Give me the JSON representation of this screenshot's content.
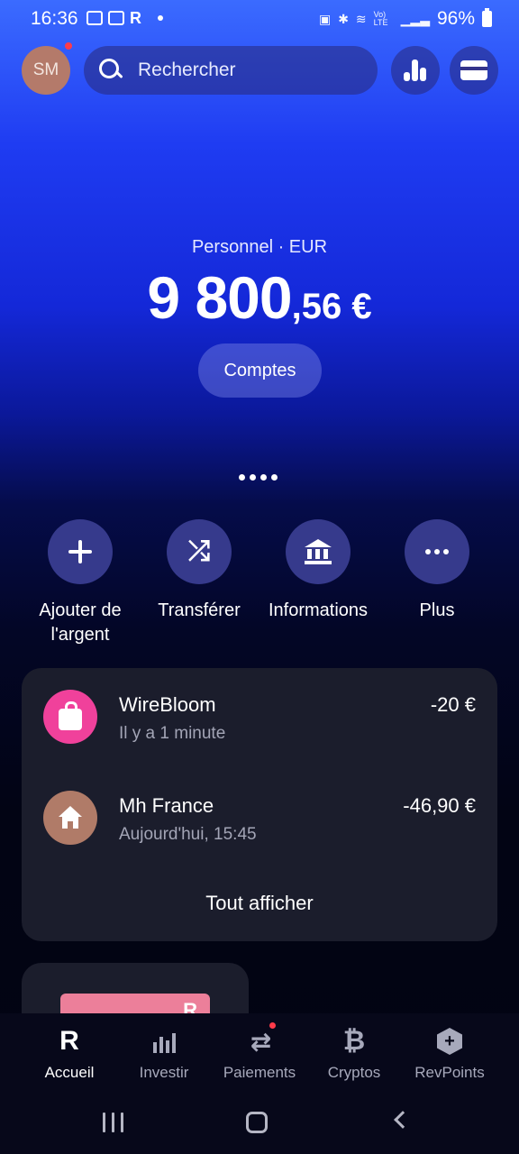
{
  "status_bar": {
    "time": "16:36",
    "r_glyph": "R",
    "battery": "96%",
    "volte": "Vo) LTE"
  },
  "header": {
    "avatar_initials": "SM",
    "search_placeholder": "Rechercher"
  },
  "balance": {
    "label": "Personnel · EUR",
    "integer": "9 800",
    "decimal": ",56 €",
    "accounts_button": "Comptes"
  },
  "actions": [
    {
      "label": "Ajouter de l'argent",
      "icon": "plus-icon"
    },
    {
      "label": "Transférer",
      "icon": "shuffle-icon"
    },
    {
      "label": "Informations",
      "icon": "bank-icon"
    },
    {
      "label": "Plus",
      "icon": "more-icon"
    }
  ],
  "transactions": [
    {
      "name": "WireBloom",
      "sub": "Il y a 1 minute",
      "amount": "-20 €",
      "icon": "shopping-bag-icon",
      "color": "#f0419b"
    },
    {
      "name": "Mh France",
      "sub": "Aujourd'hui, 15:45",
      "amount": "-46,90 €",
      "icon": "home-icon",
      "color": "#b07b68"
    }
  ],
  "transactions_show_all": "Tout afficher",
  "promo_glyph": "R",
  "bottom_nav": [
    {
      "label": "Accueil",
      "icon": "revolut-logo-icon",
      "active": true
    },
    {
      "label": "Investir",
      "icon": "investment-chart-icon",
      "active": false
    },
    {
      "label": "Paiements",
      "icon": "transfer-arrows-icon",
      "active": false
    },
    {
      "label": "Cryptos",
      "icon": "bitcoin-icon",
      "active": false
    },
    {
      "label": "RevPoints",
      "icon": "revpoints-hex-icon",
      "active": false
    }
  ],
  "nav_glyphs": {
    "home": "R",
    "payments": "⇄",
    "crypto": "₿",
    "revpoints": "+"
  },
  "colors": {
    "accent_blue": "#1f3cf2",
    "card_bg": "#1b1d2c",
    "badge_red": "#ff3b4a"
  }
}
